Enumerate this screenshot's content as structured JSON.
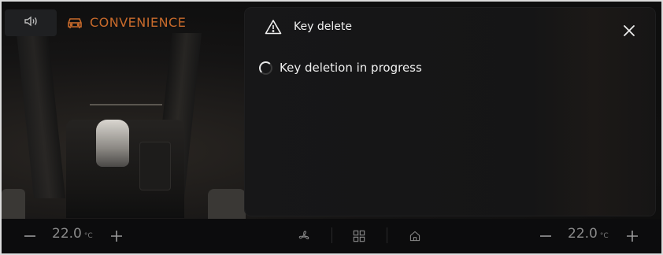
{
  "header": {
    "volume_icon": "speaker-icon",
    "mode_icon": "car-icon",
    "mode_label": "CONVENIENCE",
    "accent_color": "#c86a2b"
  },
  "popup": {
    "title": "Key delete",
    "warning_icon": "warning-triangle-icon",
    "close_icon": "close-icon",
    "status": "Key deletion in progress",
    "status_icon": "spinner-icon"
  },
  "climate": {
    "left": {
      "temperature": "22.0",
      "unit": "°C"
    },
    "right": {
      "temperature": "22.0",
      "unit": "°C"
    },
    "center_icons": [
      "fan-icon",
      "apps-grid-icon",
      "home-icon"
    ]
  }
}
